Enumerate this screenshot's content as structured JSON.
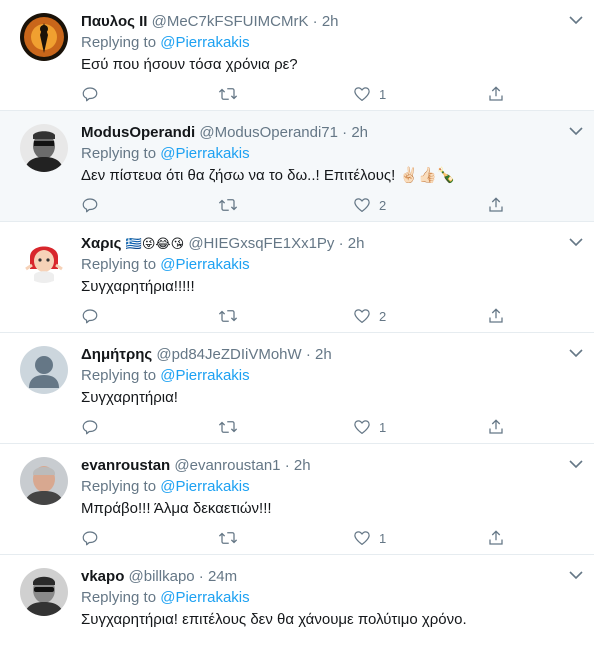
{
  "tweets": [
    {
      "name": "Παυλος II",
      "handle": "@MeC7kFSFUIMCMrK",
      "dot": "·",
      "time": "2h",
      "replying_prefix": "Replying to",
      "replying_to": "@Pierrakakis",
      "text": "Εσύ που ήσουν τόσα χρόνια ρε?",
      "likes": "1",
      "highlighted": false
    },
    {
      "name": "ModusOperandi",
      "handle": "@ModusOperandi71",
      "dot": "·",
      "time": "2h",
      "replying_prefix": "Replying to",
      "replying_to": "@Pierrakakis",
      "text": "Δεν πίστευα ότι θα ζήσω να το δω..! Επιτέλους! ✌🏻👍🏻🍾",
      "likes": "2",
      "highlighted": true
    },
    {
      "name": "Χαρις",
      "name_emojis": "🇬🇷😜😂😘",
      "handle": "@HIEGxsqFE1Xx1Py",
      "dot": "·",
      "time": "2h",
      "replying_prefix": "Replying to",
      "replying_to": "@Pierrakakis",
      "text": "Συγχαρητήρια!!!!!",
      "likes": "2",
      "highlighted": false
    },
    {
      "name": "Δημήτρης",
      "handle": "@pd84JeZDIiVMohW",
      "dot": "·",
      "time": "2h",
      "replying_prefix": "Replying to",
      "replying_to": "@Pierrakakis",
      "text": "Συγχαρητήρια!",
      "likes": "1",
      "highlighted": false
    },
    {
      "name": "evanroustan",
      "handle": "@evanroustan1",
      "dot": "·",
      "time": "2h",
      "replying_prefix": "Replying to",
      "replying_to": "@Pierrakakis",
      "text": "Μπράβο!!! Άλμα δεκαετιών!!!",
      "likes": "1",
      "highlighted": false
    },
    {
      "name": "vkapo",
      "handle": "@billkapo",
      "dot": "·",
      "time": "24m",
      "replying_prefix": "Replying to",
      "replying_to": "@Pierrakakis",
      "text": "Συγχαρητήρια! επιτέλους δεν θα χάνουμε πολύτιμο χρόνο.",
      "likes": "",
      "highlighted": false
    }
  ],
  "icons": {
    "reply": "reply-icon",
    "retweet": "retweet-icon",
    "like": "like-icon",
    "share": "share-icon",
    "caret": "chevron-down-icon"
  },
  "colors": {
    "accent": "#1da1f2",
    "secondary_text": "#657786",
    "icon": "#657786",
    "highlight_bg": "#f5f8fa",
    "divider": "#e6ecf0"
  }
}
